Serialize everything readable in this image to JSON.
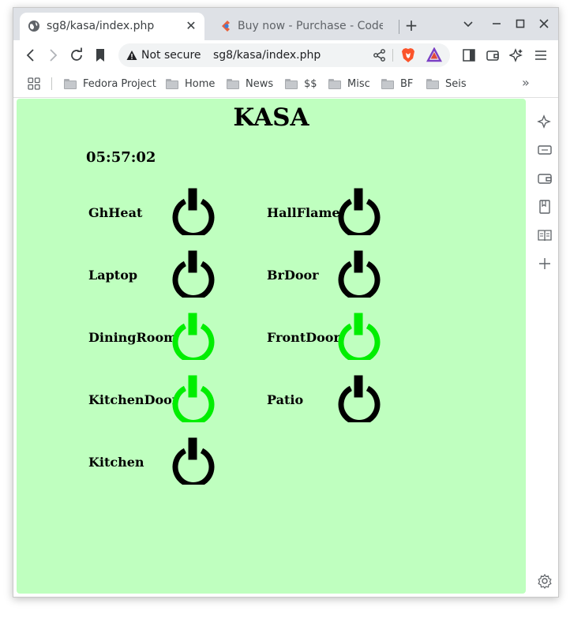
{
  "tabs": [
    {
      "title": "sg8/kasa/index.php",
      "active": true
    },
    {
      "title": "Buy now - Purchase - CodePort",
      "active": false
    }
  ],
  "toolbar": {
    "security_label": "Not secure",
    "url": "sg8/kasa/index.php"
  },
  "bookmarks": [
    "Fedora Project",
    "Home",
    "News",
    "$$",
    "Misc",
    "BF",
    "Seis"
  ],
  "page": {
    "title": "KASA",
    "clock": "05:57:02",
    "colors": {
      "on": "#00ee00",
      "off": "#000000",
      "background": "#bfffbf"
    },
    "devices": [
      {
        "name": "GhHeat",
        "state": "off"
      },
      {
        "name": "HallFlame",
        "state": "off"
      },
      {
        "name": "Laptop",
        "state": "off"
      },
      {
        "name": "BrDoor",
        "state": "off"
      },
      {
        "name": "DiningRoom",
        "state": "on"
      },
      {
        "name": "FrontDoor",
        "state": "on"
      },
      {
        "name": "KitchenDoor",
        "state": "on"
      },
      {
        "name": "Patio",
        "state": "off"
      },
      {
        "name": "Kitchen",
        "state": "off"
      }
    ]
  }
}
